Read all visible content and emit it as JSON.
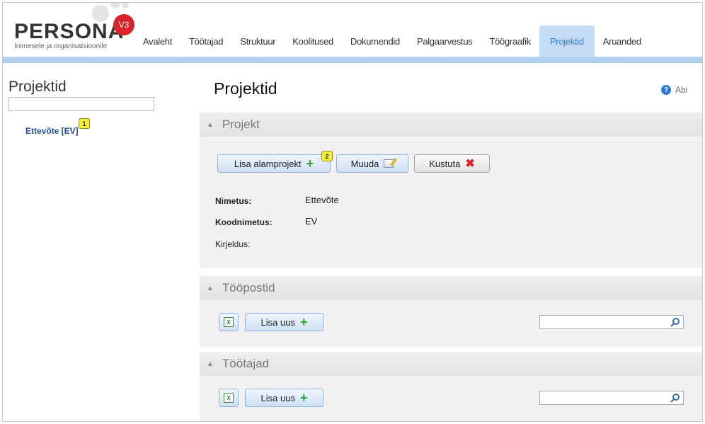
{
  "app": {
    "logo_text": "PERSONA",
    "logo_tagline": "Inimesele ja organisatsioonile",
    "logo_version": "V3"
  },
  "nav": {
    "items": [
      "Avaleht",
      "Töötajad",
      "Struktuur",
      "Koolitused",
      "Dokumendid",
      "Palgaarvestus",
      "Töögraafik",
      "Projektid",
      "Aruanded"
    ],
    "active": "Projektid"
  },
  "left": {
    "title": "Projektid",
    "search_value": "",
    "tree_item": "Ettevõte [EV]",
    "tree_badge": "1"
  },
  "main": {
    "title": "Projektid",
    "help_label": "Abi",
    "help_icon": "question-icon"
  },
  "project_panel": {
    "header": "Projekt",
    "add_sub_label": "Lisa alamprojekt",
    "add_sub_badge": "2",
    "edit_label": "Muuda",
    "delete_label": "Kustuta",
    "fields": {
      "name_label": "Nimetus:",
      "name_value": "Ettevõte",
      "code_label": "Koodnimetus:",
      "code_value": "EV",
      "desc_label": "Kirjeldus:",
      "desc_value": ""
    }
  },
  "positions_panel": {
    "header": "Tööpostid",
    "add_label": "Lisa uus",
    "search_value": ""
  },
  "employees_panel": {
    "header": "Töötajad",
    "add_label": "Lisa uus",
    "search_value": ""
  },
  "colors": {
    "accent_blue": "#3a7bc8",
    "logo_red": "#d8232a",
    "badge_yellow": "#f6ef3c",
    "add_green": "#2fa52f"
  }
}
